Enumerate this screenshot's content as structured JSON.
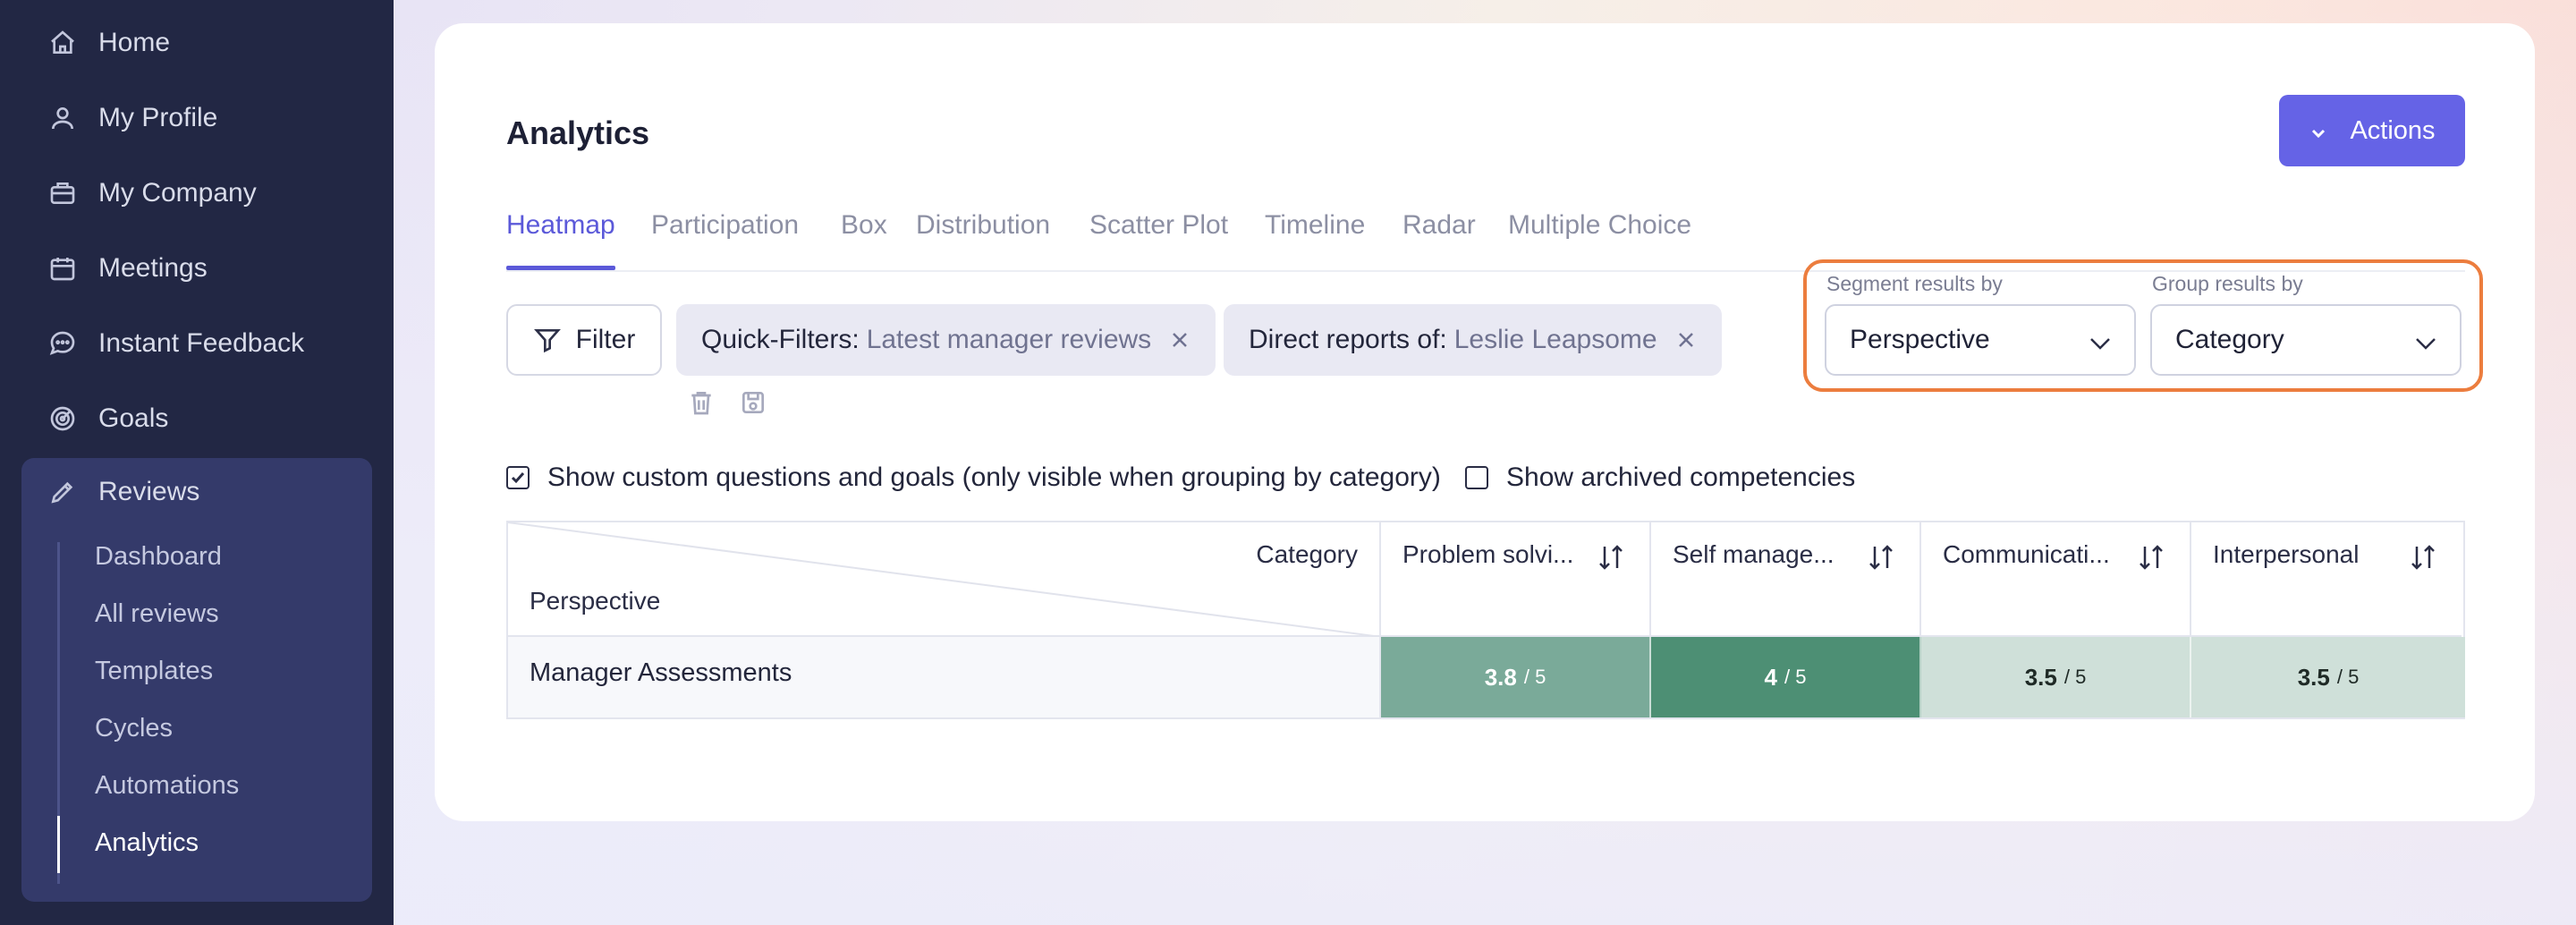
{
  "sidebar": {
    "items": [
      {
        "label": "Home",
        "icon": "home-icon"
      },
      {
        "label": "My Profile",
        "icon": "user-icon"
      },
      {
        "label": "My Company",
        "icon": "briefcase-icon"
      },
      {
        "label": "Meetings",
        "icon": "calendar-icon"
      },
      {
        "label": "Instant Feedback",
        "icon": "chat-icon"
      },
      {
        "label": "Goals",
        "icon": "target-icon"
      }
    ],
    "reviews": {
      "label": "Reviews",
      "icon": "pencil-icon",
      "subitems": [
        "Dashboard",
        "All reviews",
        "Templates",
        "Cycles",
        "Automations",
        "Analytics"
      ],
      "active": "Analytics"
    }
  },
  "main": {
    "title": "Analytics",
    "actions_label": "Actions",
    "tabs": [
      "Heatmap",
      "Participation",
      "Box",
      "Distribution",
      "Scatter Plot",
      "Timeline",
      "Radar",
      "Multiple Choice"
    ],
    "active_tab": "Heatmap",
    "filter_label": "Filter",
    "chips": [
      {
        "key": "Quick-Filters:",
        "value": "Latest manager reviews"
      },
      {
        "key": "Direct reports of:",
        "value": "Leslie Leapsome"
      }
    ],
    "segment": {
      "label": "Segment results by",
      "value": "Perspective"
    },
    "group": {
      "label": "Group results by",
      "value": "Category"
    },
    "checkboxes": [
      {
        "label": "Show custom questions and goals (only visible when grouping by category)",
        "checked": true
      },
      {
        "label": "Show archived competencies",
        "checked": false
      }
    ]
  },
  "heatmap": {
    "corner_top": "Category",
    "corner_bottom": "Perspective",
    "columns": [
      "Problem solvi...",
      "Self manage...",
      "Communicati...",
      "Interpersonal"
    ],
    "rows": [
      {
        "label": "Manager Assessments",
        "values": [
          {
            "score": "3.8",
            "outof": "/ 5",
            "color": "#7aaa99",
            "text": "#ffffff"
          },
          {
            "score": "4",
            "outof": "/ 5",
            "color": "#4d8f74",
            "text": "#ffffff"
          },
          {
            "score": "3.5",
            "outof": "/ 5",
            "color": "#cfe0d9",
            "text": "#1f2a26"
          },
          {
            "score": "3.5",
            "outof": "/ 5",
            "color": "#cfe0d9",
            "text": "#1f2a26"
          }
        ]
      }
    ]
  },
  "colors": {
    "accent": "#5b59d9",
    "highlight": "#ec7d3e",
    "sidebar": "#222744"
  }
}
